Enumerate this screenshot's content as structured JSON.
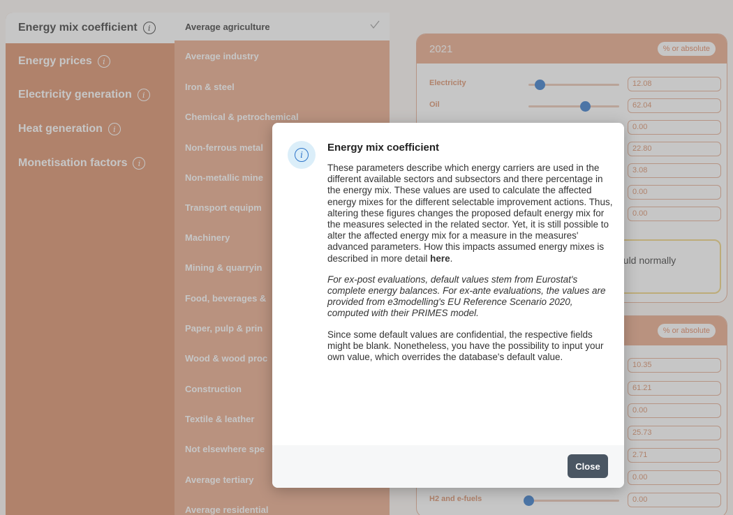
{
  "left_menu": {
    "items": [
      {
        "label": "Energy mix coefficient",
        "info_icon": "info-icon"
      },
      {
        "label": "Energy prices",
        "info_icon": "info-icon"
      },
      {
        "label": "Electricity generation",
        "info_icon": "info-icon"
      },
      {
        "label": "Heat generation",
        "info_icon": "info-icon"
      },
      {
        "label": "Monetisation factors",
        "info_icon": "info-icon"
      }
    ],
    "selected": "Energy mix coefficient"
  },
  "sub_menu": {
    "items": [
      "Average agriculture",
      "Average industry",
      "Iron & steel",
      "Chemical & petrochemical",
      "Non-ferrous metal",
      "Non-metallic mine",
      "Transport equipm",
      "Machinery",
      "Mining & quarryin",
      "Food, beverages &",
      "Paper, pulp & prin",
      "Wood & wood proc",
      "Construction",
      "Textile & leather",
      "Not elsewhere spe",
      "Average tertiary",
      "Average residential"
    ],
    "selected": "Average agriculture",
    "selected_icon": "checkmark-icon"
  },
  "panel_a": {
    "year": "2021",
    "badge": "% or absolute",
    "rows": [
      {
        "label": "Electricity",
        "value": "12.08",
        "slider_fraction": 0.12
      },
      {
        "label": "Oil",
        "value": "62.04",
        "slider_fraction": 0.62
      },
      {
        "label": "",
        "value": "0.00",
        "slider_fraction": 0
      },
      {
        "label": "",
        "value": "22.80",
        "slider_fraction": 0.23
      },
      {
        "label": "",
        "value": "3.08",
        "slider_fraction": 0.03
      },
      {
        "label": "",
        "value": "0.00",
        "slider_fraction": 0
      },
      {
        "label": "",
        "value": "0.00",
        "slider_fraction": 0
      }
    ],
    "note_fragment": "ould normally"
  },
  "panel_b": {
    "badge": "% or absolute",
    "rows": [
      {
        "label": "",
        "value": "10.35",
        "slider_fraction": 0.1
      },
      {
        "label": "",
        "value": "61.21",
        "slider_fraction": 0.61
      },
      {
        "label": "",
        "value": "0.00",
        "slider_fraction": 0
      },
      {
        "label": "",
        "value": "25.73",
        "slider_fraction": 0.26
      },
      {
        "label": "",
        "value": "2.71",
        "slider_fraction": 0.03
      },
      {
        "label": "",
        "value": "0.00",
        "slider_fraction": 0
      },
      {
        "label": "H2 and e-fuels",
        "value": "0.00",
        "slider_fraction": 0
      }
    ]
  },
  "modal": {
    "icon": "info-icon",
    "title": "Energy mix coefficient",
    "para1_text": "These parameters describe which energy carriers are used in the different available sectors and subsectors and there percentage in the energy mix. These values are used to calculate the affected energy mixes for the different selectable improvement actions. Thus, altering these figures changes the proposed default energy mix for the measures selected in the related sector. Yet, it is still possible to alter the affected energy mix for a measure in the measures' advanced parameters. How this impacts assumed energy mixes is described in more detail ",
    "para1_link": "here",
    "para1_end": ".",
    "para2": "For ex-post evaluations, default values stem from Eurostat's complete energy balances. For ex-ante evaluations, the values are provided from e3modelling's EU Reference Scenario 2020, computed with their PRIMES model.",
    "para3": "Since some default values are confidential, the respective fields might be blank. Nonetheless, you have the possibility to input your own value, which overrides the database's default value.",
    "close_label": "Close"
  },
  "colors": {
    "sidebar": "#d98a63",
    "submenu": "#e9a685",
    "accent_blue": "#2d74c9",
    "close_button": "#4a5663"
  }
}
